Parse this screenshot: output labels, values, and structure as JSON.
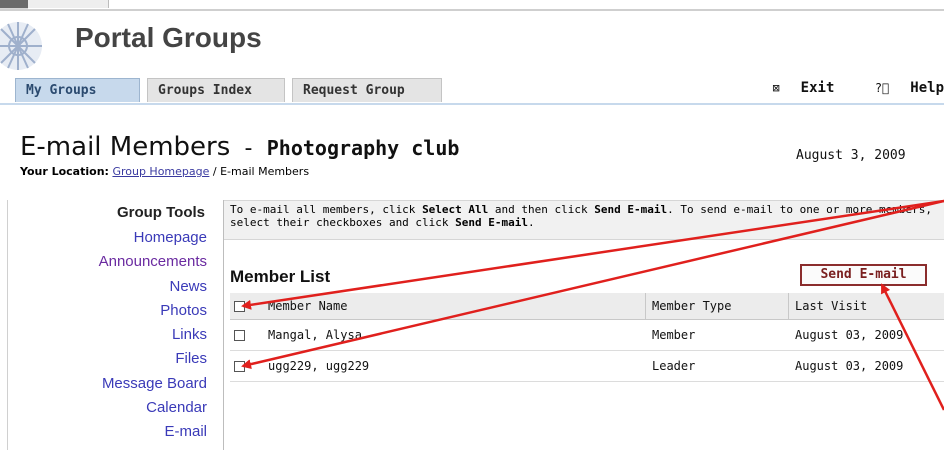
{
  "app": {
    "title": "Portal Groups"
  },
  "tabs": [
    {
      "label": "My Groups",
      "active": true
    },
    {
      "label": "Groups Index",
      "active": false
    },
    {
      "label": "Request Group",
      "active": false
    }
  ],
  "tools": {
    "exit_label": "Exit",
    "help_label": "Help"
  },
  "page": {
    "title": "E-mail Members",
    "separator": "-",
    "group_name": "Photography club",
    "date": "August 3, 2009",
    "location_label": "Your Location:",
    "breadcrumb_link": "Group Homepage",
    "breadcrumb_current": " / E-mail Members"
  },
  "sidebar": {
    "title": "Group Tools",
    "items": [
      {
        "label": "Homepage"
      },
      {
        "label": "Announcements"
      },
      {
        "label": "News"
      },
      {
        "label": "Photos"
      },
      {
        "label": "Links"
      },
      {
        "label": "Files"
      },
      {
        "label": "Message Board"
      },
      {
        "label": "Calendar"
      },
      {
        "label": "E-mail"
      }
    ]
  },
  "intro": {
    "p1": "To e-mail all members, click ",
    "b1": "Select All",
    "p2": " and then click ",
    "b2": "Send E-mail",
    "p3": ". To send e-mail to one or more members, select their checkboxes and click ",
    "b3": "Send E-mail",
    "p4": "."
  },
  "member_list": {
    "title": "Member List",
    "send_label": "Send E-mail",
    "headers": {
      "name": "Member Name",
      "type": "Member Type",
      "visit": "Last Visit"
    },
    "rows": [
      {
        "name": "Mangal, Alysa",
        "type": "Member",
        "visit": "August 03, 2009"
      },
      {
        "name": "ugg229, ugg229",
        "type": "Leader",
        "visit": "August 03, 2009"
      }
    ]
  },
  "colors": {
    "annotation_arrow": "#e0201d",
    "tab_active": "#c7d9ec",
    "button_border": "#8b2d2d"
  }
}
